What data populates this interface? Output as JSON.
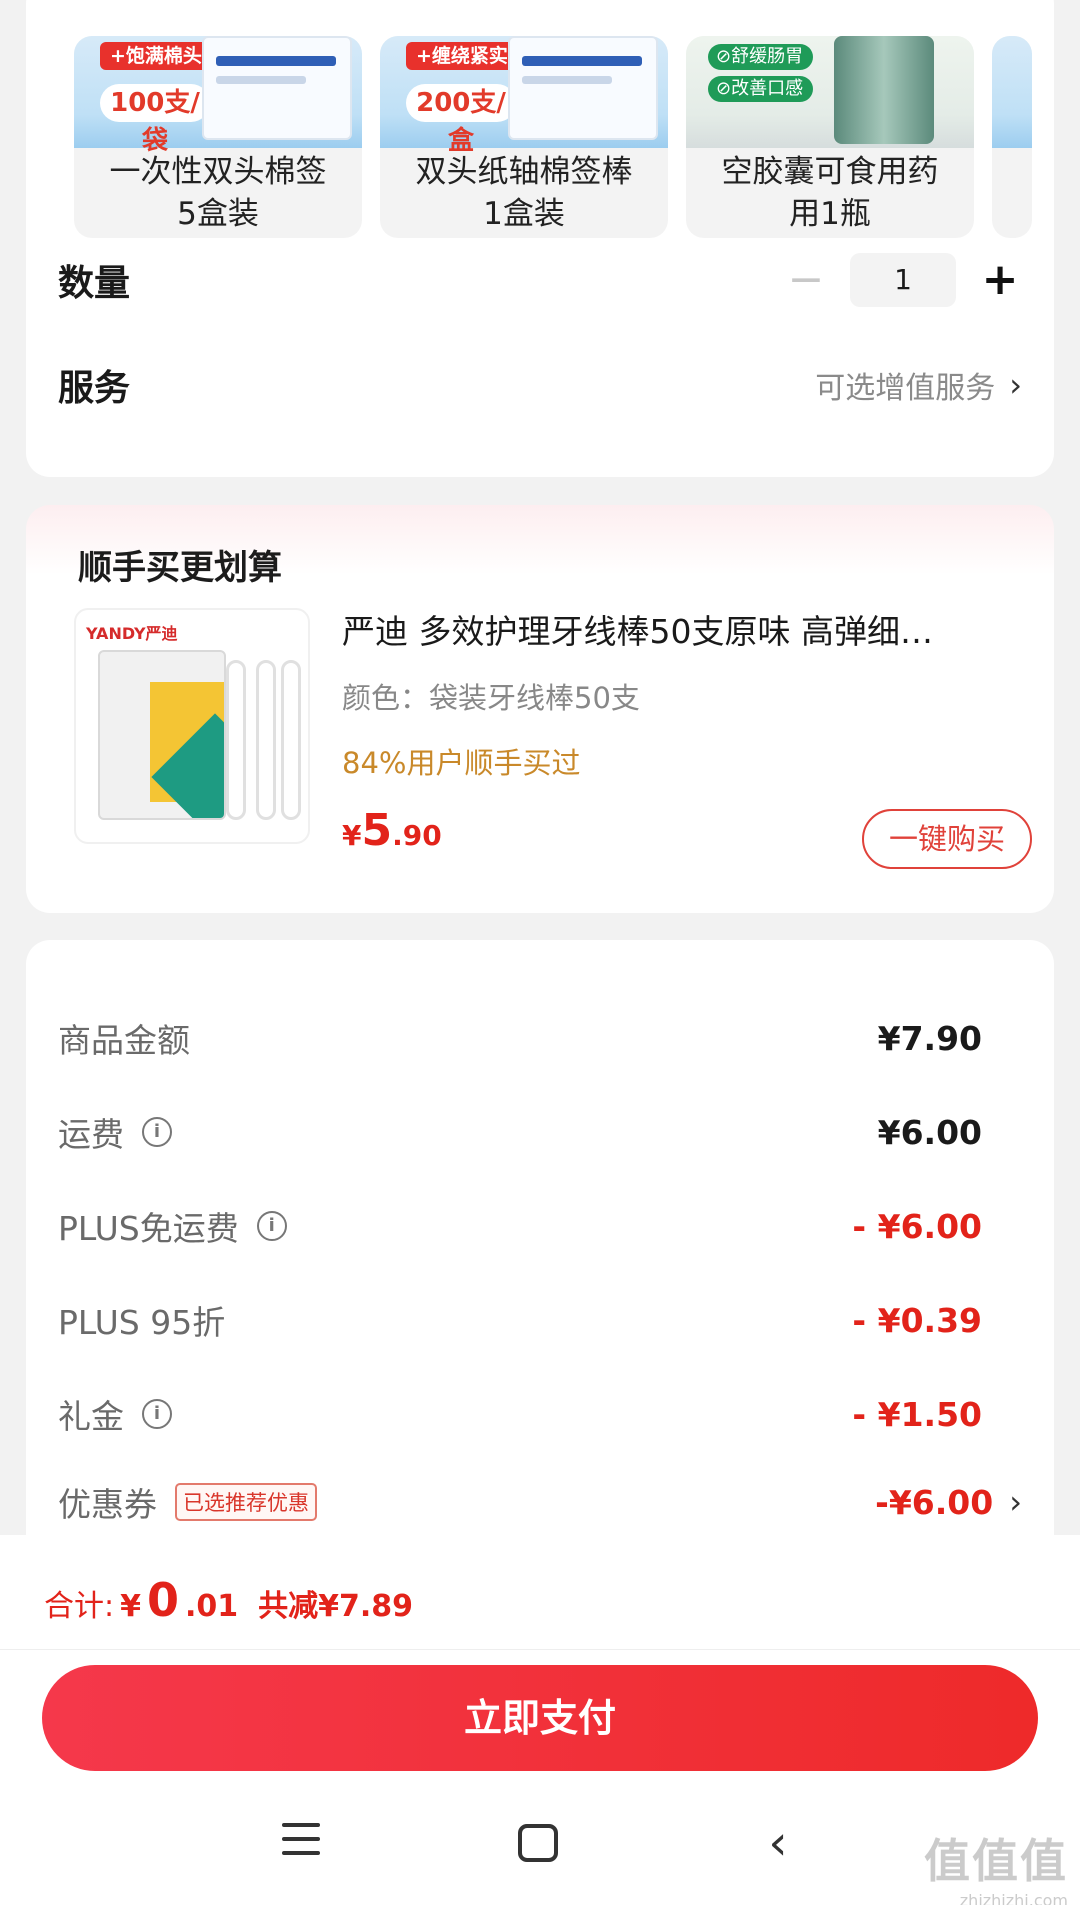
{
  "spec": {
    "variants": [
      {
        "tag": "+饱满棉头",
        "badge": "100支/袋",
        "name": "一次性双头棉签\n5盒装"
      },
      {
        "tag": "+缠绕紧实",
        "badge": "200支/盒",
        "name": "双头纸轴棉签棒\n1盒装"
      },
      {
        "tags": [
          "⊘舒缓肠胃",
          "⊘改善口感"
        ],
        "name": "空胶囊可食用药\n用1瓶"
      }
    ],
    "quantity": {
      "label": "数量",
      "value": "1",
      "minus": "−",
      "plus": "+"
    },
    "service": {
      "label": "服务",
      "hint": "可选增值服务",
      "chevron": "›"
    }
  },
  "upsell": {
    "title": "顺手买更划算",
    "thumb_logo": "YANDY严迪",
    "name": "严迪 多效护理牙线棒50支原味 高弹细…",
    "spec": "颜色：袋装牙线棒50支",
    "bought": "84%用户顺手买过",
    "price": {
      "currency": "¥",
      "integer": "5",
      "decimal": ".90"
    },
    "buy_button": "一键购买"
  },
  "details": {
    "rows": [
      {
        "label": "商品金额",
        "value": "¥7.90",
        "info": false,
        "red": false
      },
      {
        "label": "运费",
        "value": "¥6.00",
        "info": true,
        "red": false
      },
      {
        "label": "PLUS免运费",
        "value": "- ¥6.00",
        "info": true,
        "red": true
      },
      {
        "label": "PLUS 95折",
        "value": "- ¥0.39",
        "info": false,
        "red": true
      },
      {
        "label": "礼金",
        "value": "- ¥1.50",
        "info": true,
        "red": true
      }
    ],
    "coupon": {
      "label": "优惠券",
      "badge": "已选推荐优惠",
      "value": "-¥6.00",
      "chevron": "›"
    },
    "info_glyph": "i"
  },
  "footer": {
    "total_label": "合计:",
    "total_currency": "¥",
    "total_integer": "0",
    "total_decimal": ".01",
    "saving": "共减¥7.89",
    "pay_button": "立即支付",
    "back_glyph": "‹"
  },
  "watermark": {
    "big": "值值值",
    "small": "zhizhizhi.com"
  },
  "colors": {
    "accent": "#e2231a",
    "bought": "#c9892a",
    "pay_start": "#f5384b",
    "pay_end": "#ee2a2a"
  }
}
